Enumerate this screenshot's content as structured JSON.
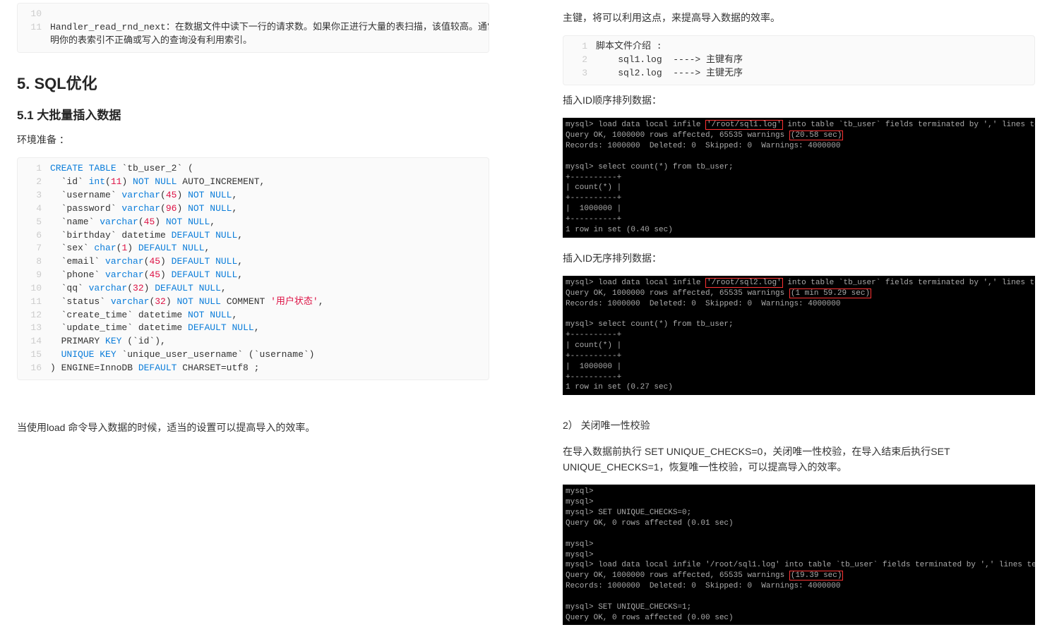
{
  "left": {
    "block1": {
      "lines": [
        {
          "n": "10",
          "txt": ""
        },
        {
          "n": "11",
          "txt": "Handler_read_rnd_next：在数据文件中读下一行的请求数。如果你正进行大量的表扫描，该值较高。通常说"
        },
        {
          "n": "",
          "txt": "明你的表索引不正确或写入的查询没有利用索引。"
        }
      ]
    },
    "h2": "5. SQL优化",
    "h3": "5.1 大批量插入数据",
    "p1": "环境准备 ：",
    "block2": {
      "lines": [
        {
          "n": "1",
          "html": "<span class='kw-blue'>CREATE</span> <span class='kw-blue'>TABLE</span> `tb_user_2` ("
        },
        {
          "n": "2",
          "html": "  `id` <span class='kw-blue'>int</span>(<span class='kw-red'>11</span>) <span class='kw-blue'>NOT</span> <span class='kw-blue'>NULL</span> AUTO_INCREMENT,"
        },
        {
          "n": "3",
          "html": "  `username` <span class='kw-blue'>varchar</span>(<span class='kw-red'>45</span>) <span class='kw-blue'>NOT</span> <span class='kw-blue'>NULL</span>,"
        },
        {
          "n": "4",
          "html": "  `password` <span class='kw-blue'>varchar</span>(<span class='kw-red'>96</span>) <span class='kw-blue'>NOT</span> <span class='kw-blue'>NULL</span>,"
        },
        {
          "n": "5",
          "html": "  `name` <span class='kw-blue'>varchar</span>(<span class='kw-red'>45</span>) <span class='kw-blue'>NOT</span> <span class='kw-blue'>NULL</span>,"
        },
        {
          "n": "6",
          "html": "  `birthday` datetime <span class='kw-blue'>DEFAULT</span> <span class='kw-blue'>NULL</span>,"
        },
        {
          "n": "7",
          "html": "  `sex` <span class='kw-blue'>char</span>(<span class='kw-red'>1</span>) <span class='kw-blue'>DEFAULT</span> <span class='kw-blue'>NULL</span>,"
        },
        {
          "n": "8",
          "html": "  `email` <span class='kw-blue'>varchar</span>(<span class='kw-red'>45</span>) <span class='kw-blue'>DEFAULT</span> <span class='kw-blue'>NULL</span>,"
        },
        {
          "n": "9",
          "html": "  `phone` <span class='kw-blue'>varchar</span>(<span class='kw-red'>45</span>) <span class='kw-blue'>DEFAULT</span> <span class='kw-blue'>NULL</span>,"
        },
        {
          "n": "10",
          "html": "  `qq` <span class='kw-blue'>varchar</span>(<span class='kw-red'>32</span>) <span class='kw-blue'>DEFAULT</span> <span class='kw-blue'>NULL</span>,"
        },
        {
          "n": "11",
          "html": "  `status` <span class='kw-blue'>varchar</span>(<span class='kw-red'>32</span>) <span class='kw-blue'>NOT</span> <span class='kw-blue'>NULL</span> COMMENT <span class='kw-red'>'用户状态'</span>,"
        },
        {
          "n": "12",
          "html": "  `create_time` datetime <span class='kw-blue'>NOT</span> <span class='kw-blue'>NULL</span>,"
        },
        {
          "n": "13",
          "html": "  `update_time` datetime <span class='kw-blue'>DEFAULT</span> <span class='kw-blue'>NULL</span>,"
        },
        {
          "n": "14",
          "html": "  PRIMARY <span class='kw-blue'>KEY</span> (`id`),"
        },
        {
          "n": "15",
          "html": "  <span class='kw-blue'>UNIQUE</span> <span class='kw-blue'>KEY</span> `unique_user_username` (`username`)"
        },
        {
          "n": "16",
          "html": ") ENGINE=InnoDB <span class='kw-blue'>DEFAULT</span> CHARSET=utf8 ;"
        }
      ]
    },
    "p2": "当使用load 命令导入数据的时候，适当的设置可以提高导入的效率。"
  },
  "right": {
    "p0": "主键，将可以利用这点，来提高导入数据的效率。",
    "block1": {
      "lines": [
        {
          "n": "1",
          "txt": "脚本文件介绍 :"
        },
        {
          "n": "2",
          "txt": "    sql1.log  ----> 主键有序"
        },
        {
          "n": "3",
          "txt": "    sql2.log  ----> 主键无序"
        }
      ]
    },
    "p1": "插入ID顺序排列数据：",
    "term1": "mysql> load data local infile <span class='hl-red'>'/root/sql1.log'</span> into table `tb_user` fields terminated by ',' lines terminated by '\\n';\nQuery OK, 1000000 rows affected, 65535 warnings <span class='hl-red'>(20.58 sec)</span>\nRecords: 1000000  Deleted: 0  Skipped: 0  Warnings: 4000000\n\nmysql> select count(*) from tb_user;\n+----------+\n| count(*) |\n+----------+\n|  1000000 |\n+----------+\n1 row in set (0.40 sec)",
    "p2": "插入ID无序排列数据：",
    "term2": "mysql> load data local infile <span class='hl-red'>'/root/sql2.log'</span> into table `tb_user` fields terminated by ',' lines terminated by '\\n';\nQuery OK, 1000000 rows affected, 65535 warnings <span class='hl-red'>(1 min 59.29 sec)</span>\nRecords: 1000000  Deleted: 0  Skipped: 0  Warnings: 4000000\n\nmysql> select count(*) from tb_user;\n+----------+\n| count(*) |\n+----------+\n|  1000000 |\n+----------+\n1 row in set (0.27 sec)",
    "p3": "2） 关闭唯一性校验",
    "p4": "在导入数据前执行 SET UNIQUE_CHECKS=0，关闭唯一性校验，在导入结束后执行SET UNIQUE_CHECKS=1，恢复唯一性校验，可以提高导入的效率。",
    "term3": "mysql>\nmysql>\nmysql> SET UNIQUE_CHECKS=0;\nQuery OK, 0 rows affected (0.01 sec)\n\nmysql>\nmysql>\nmysql> load data local infile '/root/sql1.log' into table `tb_user` fields terminated by ',' lines terminated by '\\n';\nQuery OK, 1000000 rows affected, 65535 warnings <span class='hl-red'>(19.39 sec)</span>\nRecords: 1000000  Deleted: 0  Skipped: 0  Warnings: 4000000\n\nmysql> SET UNIQUE_CHECKS=1;\nQuery OK, 0 rows affected (0.00 sec)"
  }
}
